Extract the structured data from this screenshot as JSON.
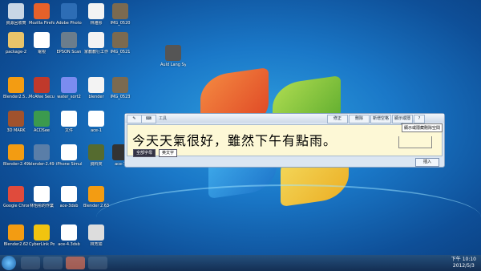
{
  "desktop_icons": [
    {
      "label": "資源回收筒",
      "color": "#c8d6e5"
    },
    {
      "label": "Mozilla Firefox",
      "color": "#e6612a"
    },
    {
      "label": "Adobe Photoshop...",
      "color": "#2d6db5"
    },
    {
      "label": "林雅彤",
      "color": "#f3f3f3"
    },
    {
      "label": "IMG_0520",
      "color": "#7b6a50"
    },
    {
      "label": "package-2",
      "color": "#e9c46a"
    },
    {
      "label": "電視",
      "color": "#ffffff"
    },
    {
      "label": "EPSON Scan",
      "color": "#6b7d8c"
    },
    {
      "label": "家教教行工作",
      "color": "#f3f3f3"
    },
    {
      "label": "IMG_0521",
      "color": "#7b6a50"
    },
    {
      "label": "Auld Lang Syne - Cl...",
      "color": "#555"
    },
    {
      "label": "Blender2.5...",
      "color": "#f39c12"
    },
    {
      "label": "McAfee Securi...",
      "color": "#c0392b"
    },
    {
      "label": "water_sort2",
      "color": "#7b8cf0"
    },
    {
      "label": "blender",
      "color": "#f3f3f3"
    },
    {
      "label": "IMG_0523",
      "color": "#7b6a50"
    },
    {
      "label": "3D MARK",
      "color": "#a0522d"
    },
    {
      "label": "ACDSee",
      "color": "#3b9a4e"
    },
    {
      "label": "文件",
      "color": "#ffffff"
    },
    {
      "label": "ace-1",
      "color": "#ffffff"
    },
    {
      "label": "Blender-2.49b-32",
      "color": "#f39c12"
    },
    {
      "label": "blender-2.49b...",
      "color": "#5a7ea8"
    },
    {
      "label": "iPhone Simulator",
      "color": "#ffffff"
    },
    {
      "label": "資料夾",
      "color": "#556b2f"
    },
    {
      "label": "ace-7",
      "color": "#333"
    },
    {
      "label": "Google Chrome",
      "color": "#e04b3c"
    },
    {
      "label": "林怡彤的作業",
      "color": "#ffffff"
    },
    {
      "label": "ace-3dsb",
      "color": "#ffffff"
    },
    {
      "label": "Blender 2.63",
      "color": "#f39c12"
    },
    {
      "label": "Blender2.62",
      "color": "#f39c12"
    },
    {
      "label": "CyberLink PowerDVD 9",
      "color": "#f1c40f"
    },
    {
      "label": "ace-4.3dsb",
      "color": "#ffffff"
    },
    {
      "label": "林芳如",
      "color": "#ddd"
    }
  ],
  "input_panel": {
    "toolbar_label": "工具",
    "buttons": [
      "修正",
      "刪除",
      "新增空格",
      "顯示或隱藏",
      "?"
    ],
    "handwriting_text": "今天天氣很好，雖然下午有點雨。",
    "tooltip": "顯示或隱藏刪除空間",
    "mode_all": "全部字母",
    "mode_lang": "英文字",
    "insert_label": "插入"
  },
  "taskbar": {
    "time": "下午 10:10",
    "date": "2012/5/3"
  }
}
